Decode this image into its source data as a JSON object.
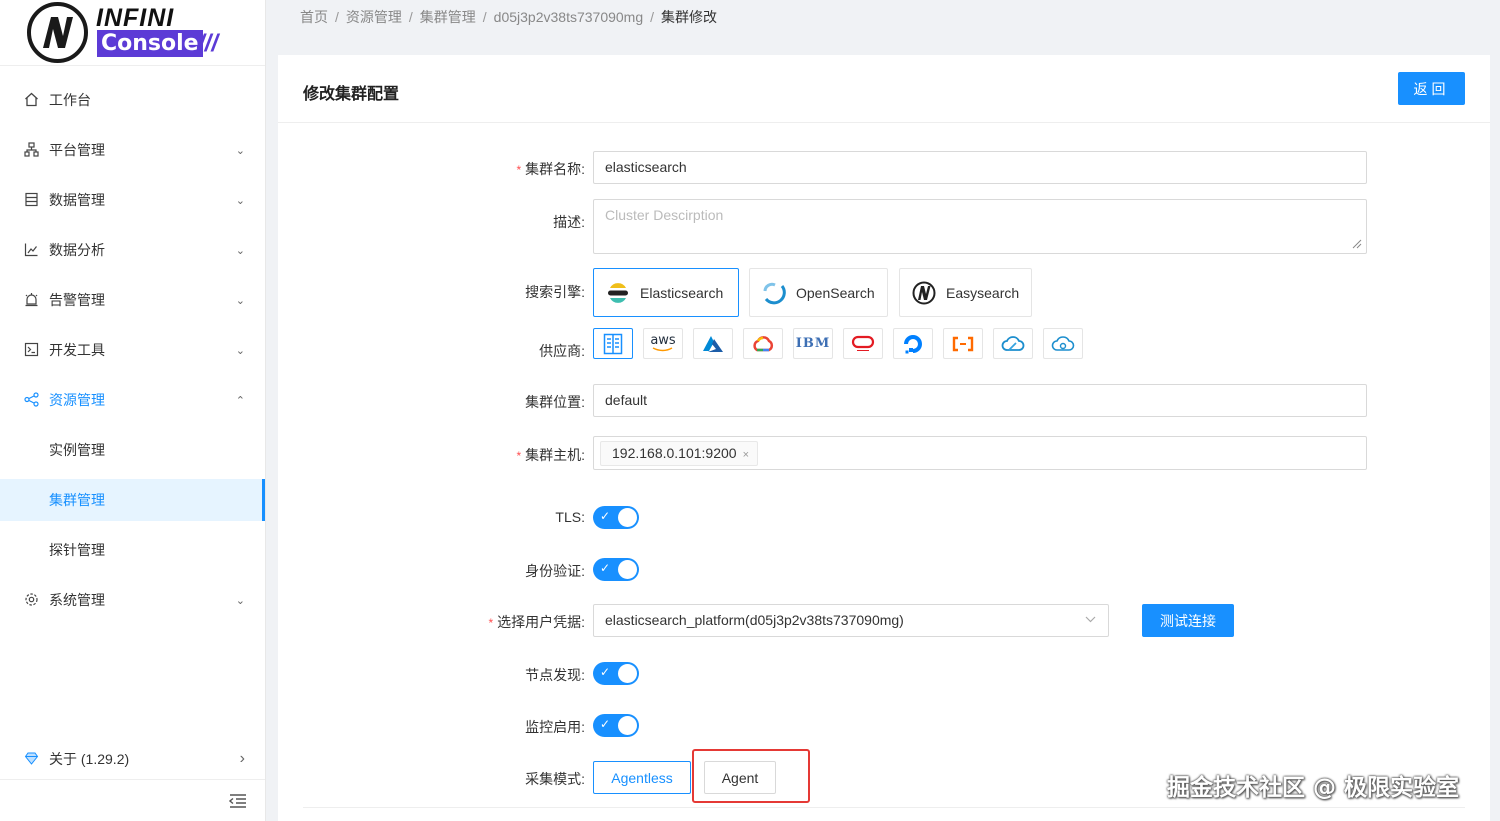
{
  "brand": {
    "line1": "INFINI",
    "line2": "Console",
    "slashes": "///"
  },
  "menu": [
    {
      "label": "工作台",
      "icon": "home-icon",
      "arrow": ""
    },
    {
      "label": "平台管理",
      "icon": "cluster-icon",
      "arrow": "⌄"
    },
    {
      "label": "数据管理",
      "icon": "database-icon",
      "arrow": "⌄"
    },
    {
      "label": "数据分析",
      "icon": "chart-icon",
      "arrow": "⌄"
    },
    {
      "label": "告警管理",
      "icon": "alarm-icon",
      "arrow": "⌄"
    },
    {
      "label": "开发工具",
      "icon": "terminal-icon",
      "arrow": "⌄"
    },
    {
      "label": "资源管理",
      "icon": "share-icon",
      "arrow": "⌃"
    },
    {
      "label": "实例管理",
      "icon": "",
      "arrow": ""
    },
    {
      "label": "集群管理",
      "icon": "",
      "arrow": ""
    },
    {
      "label": "探针管理",
      "icon": "",
      "arrow": ""
    },
    {
      "label": "系统管理",
      "icon": "settings-icon",
      "arrow": "⌄"
    }
  ],
  "about": {
    "label": "关于 (1.29.2)",
    "arrow": "›"
  },
  "breadcrumb": [
    "首页",
    "资源管理",
    "集群管理",
    "d05j3p2v38ts737090mg",
    "集群修改"
  ],
  "breadcrumb_sep": "/",
  "page": {
    "title": "修改集群配置",
    "back_label": "返回"
  },
  "form": {
    "name": {
      "label": "集群名称:",
      "value": "elasticsearch"
    },
    "desc": {
      "label": "描述:",
      "placeholder": "Cluster Descirption"
    },
    "engine": {
      "label": "搜索引擎:",
      "options": [
        "Elasticsearch",
        "OpenSearch",
        "Easysearch"
      ],
      "selected": "Elasticsearch"
    },
    "provider": {
      "label": "供应商:",
      "options": [
        "on-premise",
        "aws",
        "azure",
        "gcp",
        "ibm",
        "oracle",
        "digitalocean",
        "alibaba",
        "tencent",
        "huawei"
      ],
      "aws_text": "aws",
      "ibm_text": "IBM"
    },
    "location": {
      "label": "集群位置:",
      "value": "default"
    },
    "hosts": {
      "label": "集群主机:",
      "tags": [
        "192.168.0.101:9200"
      ],
      "close": "×"
    },
    "tls": {
      "label": "TLS:",
      "on": true
    },
    "auth": {
      "label": "身份验证:",
      "on": true
    },
    "credential": {
      "label": "选择用户凭据:",
      "value": "elasticsearch_platform(d05j3p2v38ts737090mg)",
      "test_label": "测试连接"
    },
    "discovery": {
      "label": "节点发现:",
      "on": true
    },
    "monitor": {
      "label": "监控启用:",
      "on": true
    },
    "mode": {
      "label": "采集模式:",
      "options": [
        "Agentless",
        "Agent"
      ],
      "selected": "Agentless"
    }
  },
  "switch_check": "✓",
  "required_mark": "*",
  "watermark": "掘金技术社区 @ 极限实验室",
  "colors": {
    "primary": "#1890ff",
    "brand": "#5c3bd6",
    "highlight": "#e53935"
  }
}
